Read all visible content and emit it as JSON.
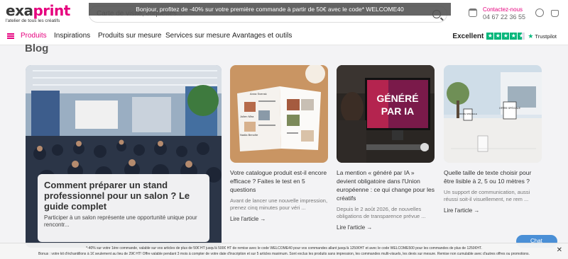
{
  "header": {
    "logo_prefix": "exa",
    "logo_accent": "print",
    "logo_tagline": "l'atelier de tous les créatifs",
    "search_placeholder": "Carte de visite, étiquettes...",
    "promo": "Bonjour, profitez de -40% sur votre première commande à partir de 50€ avec le code* WELCOME40",
    "contact_label": "Contactez-nous",
    "contact_phone": "04 67 22 36 55"
  },
  "nav": {
    "items": [
      {
        "label": "Produits"
      },
      {
        "label": "Inspirations"
      },
      {
        "label": "Produits sur mesure"
      },
      {
        "label": "Services sur mesure"
      },
      {
        "label": "Avantages et outils"
      }
    ],
    "trustpilot": {
      "rating_label": "Excellent",
      "brand": "Trustpilot",
      "stars": 4.5
    }
  },
  "blog": {
    "title": "Blog",
    "feature": {
      "title": "Comment préparer un stand professionnel pour un salon ? Le guide complet",
      "excerpt": "Participer à un salon représente une opportunité unique pour rencontr..."
    },
    "cards": [
      {
        "title": "Votre catalogue produit est-il encore efficace ? Faites le test en 5 questions",
        "excerpt": "Avant de lancer une nouvelle impression, prenez cinq minutes pour véri ...",
        "link": "Lire l'article →",
        "image_text_1": "Anna Svensk",
        "image_text_2": "Julien Mira",
        "image_text_3": "Nadia Benoîte"
      },
      {
        "title": "La mention « généré par IA » devient obligatoire dans l'Union européenne : ce qui change pour les créatifs",
        "excerpt": "Depuis le 2 août 2026, de nouvelles obligations de transparence prévue ...",
        "link": "Lire l'article →",
        "image_text_1": "GÉNÉRÉ",
        "image_text_2": "PAR IA"
      },
      {
        "title": "Quelle taille de texte choisir pour être lisible à 2, 5 ou 10 mètres ?",
        "excerpt": "Un support de communication, aussi réussi soit-il visuellement, ne rem ...",
        "link": "Lire l'article →",
        "image_text_1": "OFFRE SPÉCIALE",
        "image_text_2": "OFFRE SPÉCIALE"
      }
    ]
  },
  "chat": {
    "label": "Chat"
  },
  "bottom_banner": {
    "line1": "*-40% sur votre 1ère commande, valable sur vos articles de plus de 50€ HT jusqu'à 500€ HT de remise avec le code WELCOME40 pour vos commandes allant jusqu'à 1250€HT et avec le code WELCOME500 pour les commandes de plus de 1250€HT.",
    "line2": "Bonus : votre kit d'échantillons à 1€ seulement au lieu de 29€ HT! Offre valable pendant 3 mois à compter de votre date d'inscription et sur 5 articles maximum. Sont exclus les produits sans impression, les commandes multi-visuels, les devis sur mesure. Remise non cumulable avec d'autres offres ou promotions.",
    "close": "✕"
  },
  "colors": {
    "brand": "#e6007e",
    "trustpilot": "#00b67a",
    "chat": "#4a8fd6"
  }
}
